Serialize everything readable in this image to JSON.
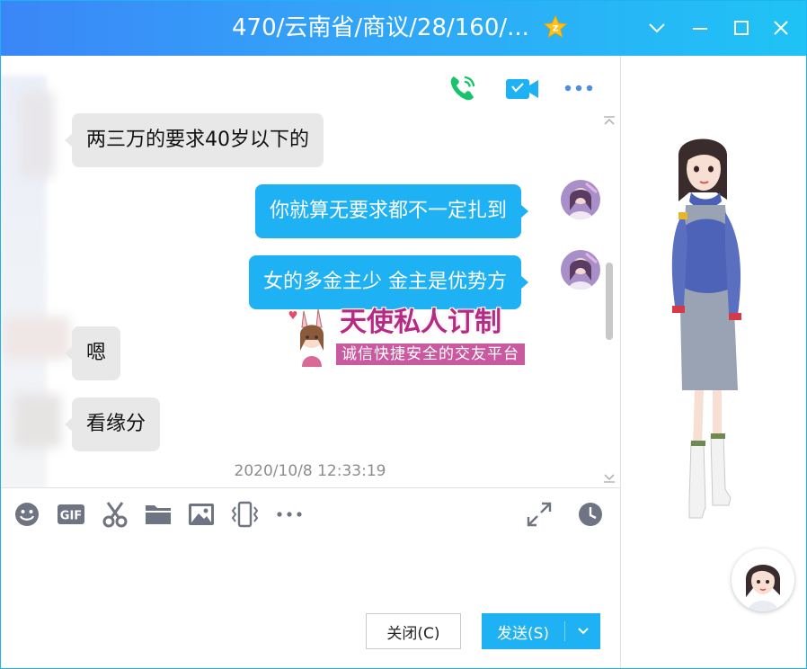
{
  "window": {
    "title": "470/云南省/商议/28/160/...",
    "accent_color": "#1eb1f4",
    "icons": [
      "vip-star-icon",
      "chevron-down-icon",
      "minimize-icon",
      "maximize-icon",
      "close-icon"
    ]
  },
  "chat_header": {
    "icons": [
      "phone-call-icon",
      "video-call-icon",
      "more-options-icon"
    ]
  },
  "messages": [
    {
      "direction": "in",
      "text": "两三万的要求40岁以下的"
    },
    {
      "direction": "out",
      "text": "你就算无要求都不一定扎到"
    },
    {
      "direction": "out",
      "text": "女的多金主少 金主是优势方"
    },
    {
      "direction": "out",
      "type": "sticker",
      "title": "天使私人订制",
      "subtitle": "诚信快捷安全的交友平台"
    },
    {
      "direction": "in",
      "text": "嗯"
    },
    {
      "direction": "in",
      "text": "看缘分"
    }
  ],
  "timestamp": "2020/10/8 12:33:19",
  "toolbar": {
    "icons": [
      "emoji-icon",
      "gif-icon",
      "scissors-icon",
      "folder-icon",
      "image-icon",
      "shake-icon",
      "more-tools-icon",
      "expand-icon",
      "history-clock-icon"
    ]
  },
  "actions": {
    "close_label": "关闭(C)",
    "send_label": "发送(S)"
  }
}
